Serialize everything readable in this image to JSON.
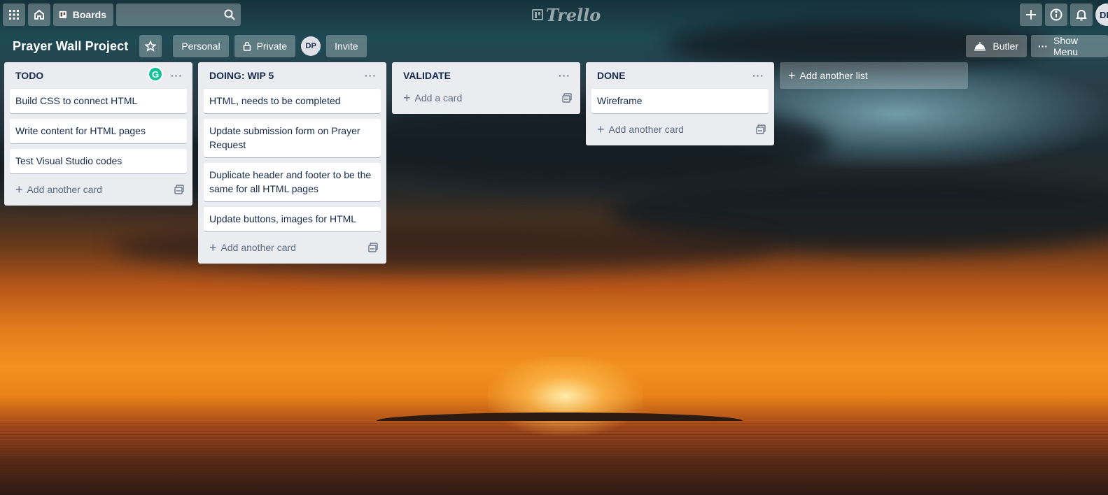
{
  "header": {
    "boards_label": "Boards",
    "logo_text": "Trello",
    "avatar_initials": "DP"
  },
  "board": {
    "title": "Prayer Wall Project",
    "team_label": "Personal",
    "visibility_label": "Private",
    "member_initials": "DP",
    "invite_label": "Invite",
    "butler_label": "Butler",
    "show_menu_label": "Show Menu"
  },
  "lists": [
    {
      "title": "TODO",
      "cards": [
        "Build CSS to connect HTML",
        "Write content for HTML pages",
        "Test Visual Studio codes"
      ],
      "add_label": "Add another card"
    },
    {
      "title": "DOING: WIP 5",
      "cards": [
        "HTML, needs to be completed",
        "Update submission form on Prayer Request",
        "Duplicate header and footer to be the same for all HTML pages",
        "Update buttons, images for HTML"
      ],
      "add_label": "Add another card"
    },
    {
      "title": "VALIDATE",
      "cards": [],
      "add_label": "Add a card"
    },
    {
      "title": "DONE",
      "cards": [
        "Wireframe"
      ],
      "add_label": "Add another card"
    }
  ],
  "add_list_label": "Add another list",
  "grammarly_letter": "G",
  "colors": {
    "list_bg": "#ebecf0",
    "card_text": "#172b4d",
    "muted_text": "#5e6c84",
    "grammarly": "#15c39a"
  }
}
